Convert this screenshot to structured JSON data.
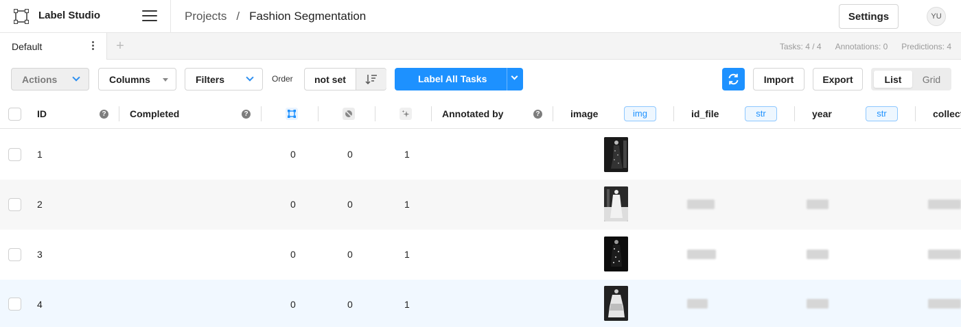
{
  "app": {
    "name": "Label Studio",
    "user_initials": "YU"
  },
  "breadcrumb": {
    "projects": "Projects",
    "separator": "/",
    "current": "Fashion Segmentation"
  },
  "header": {
    "settings_label": "Settings"
  },
  "tabs": [
    {
      "label": "Default"
    }
  ],
  "stats": {
    "tasks": "Tasks: 4 / 4",
    "annotations": "Annotations: 0",
    "predictions": "Predictions: 4"
  },
  "toolbar": {
    "actions": "Actions",
    "columns": "Columns",
    "filters": "Filters",
    "order_label": "Order",
    "order_value": "not set",
    "label_all": "Label All Tasks",
    "import": "Import",
    "export": "Export",
    "view_list": "List",
    "view_grid": "Grid"
  },
  "columns": {
    "id": "ID",
    "completed": "Completed",
    "annotated_by": "Annotated by",
    "image": "image",
    "image_type": "img",
    "id_file": "id_file",
    "id_file_type": "str",
    "year": "year",
    "year_type": "str",
    "collection": "collect"
  },
  "rows": [
    {
      "id": "1",
      "total_annotations": "0",
      "cancelled": "0",
      "predictions": "1"
    },
    {
      "id": "2",
      "total_annotations": "0",
      "cancelled": "0",
      "predictions": "1"
    },
    {
      "id": "3",
      "total_annotations": "0",
      "cancelled": "0",
      "predictions": "1"
    },
    {
      "id": "4",
      "total_annotations": "0",
      "cancelled": "0",
      "predictions": "1"
    }
  ],
  "colors": {
    "accent": "#1d91ff",
    "row_alt": "#f7f7f7",
    "row_highlight": "#f1f8ff"
  }
}
